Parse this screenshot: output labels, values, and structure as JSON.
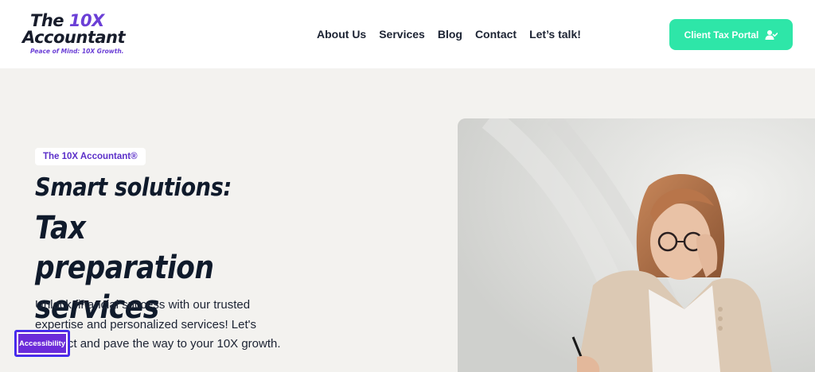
{
  "header": {
    "logo": {
      "line1_prefix": "The ",
      "line1_accent": "10X",
      "line2": "Accountant",
      "tagline": "Peace of Mind: 10X Growth."
    },
    "nav": [
      {
        "label": "About Us"
      },
      {
        "label": "Services"
      },
      {
        "label": "Blog"
      },
      {
        "label": "Contact"
      },
      {
        "label": "Let’s talk!"
      }
    ],
    "portal_button": {
      "label": "Client Tax Portal",
      "icon": "user-check-icon"
    }
  },
  "hero": {
    "badge": "The 10X Accountant®",
    "title_line1": "Smart solutions:",
    "title_line2": "Tax preparation services",
    "description": "Unlock financial success with our trusted expertise and personalized services! Let's connect and pave the way to your 10X growth.",
    "image": "woman-writing-photo"
  },
  "accessibility_button": {
    "label": "Accessibility"
  },
  "colors": {
    "brand_purple": "#6b3fd6",
    "accent_green": "#2ee6a8",
    "background": "#f3f2ef",
    "text_dark": "#0f1a2b"
  }
}
